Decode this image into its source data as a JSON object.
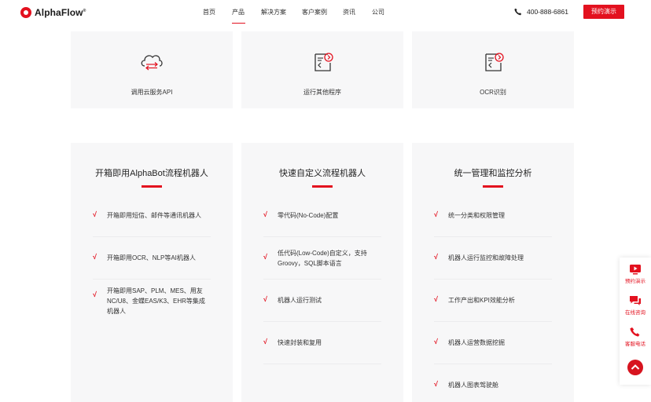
{
  "header": {
    "logo_text": "AlphaFlow",
    "logo_mark": "®",
    "nav": [
      "首页",
      "产品",
      "解决方案",
      "客户案例",
      "资讯",
      "公司"
    ],
    "active_nav": "产品",
    "phone": "400-888-6861",
    "demo_button": "预约演示"
  },
  "tiles": [
    {
      "label": "调用云服务API",
      "icon": "cloud-sync-icon"
    },
    {
      "label": "运行其他程序",
      "icon": "code-window-icon"
    },
    {
      "label": "OCR识别",
      "icon": "ocr-window-icon"
    }
  ],
  "columns": [
    {
      "title": "开箱即用AlphaBot流程机器人",
      "items": [
        "开箱即用短信、邮件等通讯机器人",
        "开箱即用OCR、NLP等AI机器人",
        "开箱即用SAP、PLM、MES、用友NC/U8、金蝶EAS/K3、EHR等集成机器人"
      ]
    },
    {
      "title": "快速自定义流程机器人",
      "items": [
        "零代码(No-Code)配置",
        "低代码(Low-Code)自定义，支持Groovy，SQL脚本语言",
        "机器人运行测试",
        "快速封装和复用"
      ]
    },
    {
      "title": "统一管理和监控分析",
      "items": [
        "统一分类和权限管理",
        "机器人运行监控和故障处理",
        "工作产出和KPI效能分析",
        "机器人运营数据挖掘",
        "机器人图表驾驶舱"
      ]
    }
  ],
  "check_glyph": "√",
  "side": {
    "items": [
      "预约演示",
      "在线咨询",
      "客服电话"
    ],
    "to_top_icon": "arrow-up-icon"
  },
  "colors": {
    "accent": "#e3111f",
    "tile_bg": "#f7f7f8"
  }
}
